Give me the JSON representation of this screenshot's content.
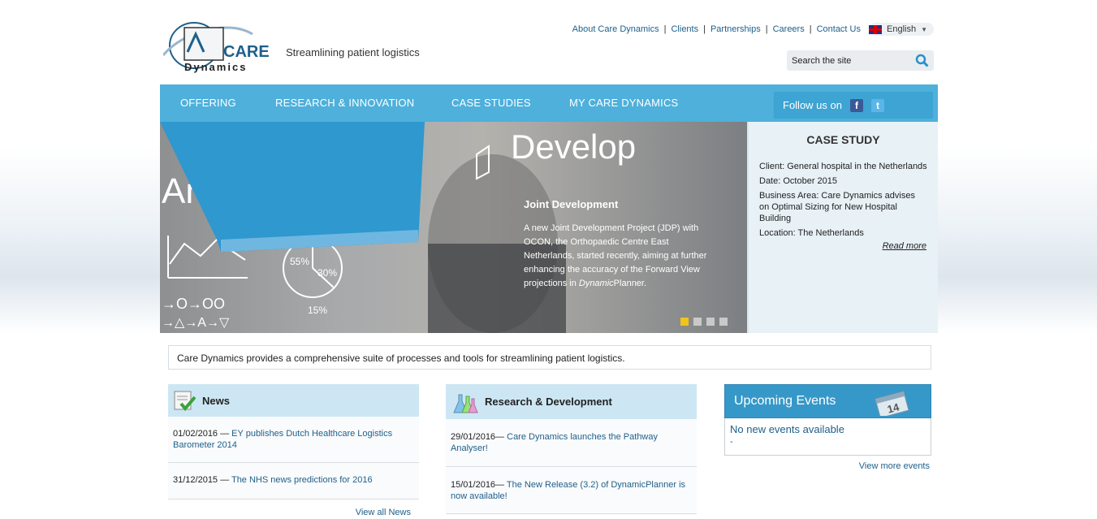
{
  "header": {
    "logo_text_top": "CARE",
    "logo_text_bottom": "Dynamics",
    "tagline": "Streamlining patient logistics",
    "toplinks": [
      "About Care Dynamics",
      "Clients",
      "Partnerships",
      "Careers",
      "Contact Us"
    ],
    "language": "English",
    "search_placeholder": "Search the site"
  },
  "nav": {
    "items": [
      "OFFERING",
      "RESEARCH & INNOVATION",
      "CASE STUDIES",
      "MY CARE DYNAMICS"
    ],
    "follow_label": "Follow us on"
  },
  "banner": {
    "words": [
      "Analyze",
      "Develop"
    ],
    "chart_labels": [
      "55%",
      "30%",
      "15%"
    ],
    "title": "Joint Development",
    "text_pre": "A new Joint Development Project (JDP) with OCON, the Orthopaedic Centre East Netherlands, started recently, aiming at further enhancing the accuracy of the Forward View projections in ",
    "text_italic": "Dynamic",
    "text_post": "Planner.",
    "slides_total": 4,
    "active_slide": 1
  },
  "case_study": {
    "heading": "CASE STUDY",
    "client": "Client: General hospital in the Netherlands",
    "date": "Date: October 2015",
    "area": "Business Area: Care Dynamics advises on Optimal Sizing for New Hospital Building",
    "location": "Location: The Netherlands",
    "read_more": "Read more"
  },
  "intro": "Care Dynamics provides a comprehensive suite of processes and tools for streamlining patient logistics.",
  "news": {
    "heading": "News",
    "items": [
      {
        "date": "01/02/2016 — ",
        "title": "EY publishes Dutch Healthcare Logistics Barometer 2014"
      },
      {
        "date": "31/12/2015 — ",
        "title": "The NHS news predictions for 2016"
      }
    ],
    "more": "View all News"
  },
  "rnd": {
    "heading": "Research & Development",
    "items": [
      {
        "date": "29/01/2016— ",
        "title": "Care Dynamics launches the Pathway Analyser!"
      },
      {
        "date": "15/01/2016— ",
        "title": "The New Release (3.2) of DynamicPlanner is now available!"
      }
    ]
  },
  "events": {
    "heading": "Upcoming Events",
    "calendar_day": "14",
    "none": "No new events available",
    "dash": "-",
    "more": "View more events"
  },
  "colors": {
    "nav_bg": "#4eb0db",
    "accent_blue": "#3698c8",
    "link": "#1e5f8a",
    "active_dot": "#f0c419"
  }
}
